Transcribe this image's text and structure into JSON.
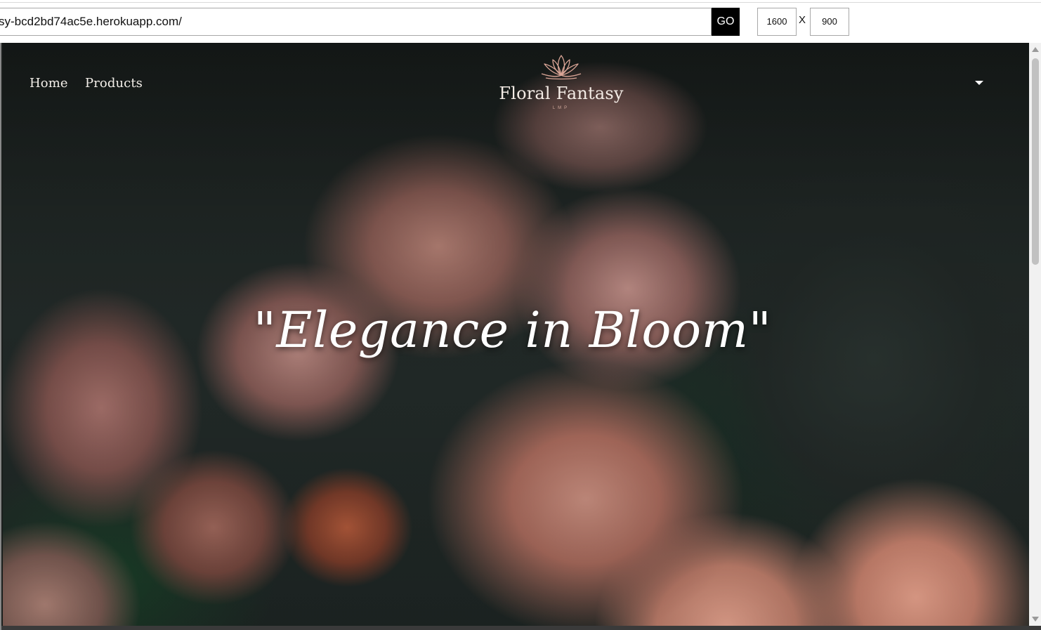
{
  "tester": {
    "url": "sy-bcd2bd74ac5e.herokuapp.com/",
    "go_label": "GO",
    "width_value": "1600",
    "separator": "X",
    "height_value": "900"
  },
  "site": {
    "nav": {
      "home_label": "Home",
      "products_label": "Products"
    },
    "logo": {
      "name": "Floral Fantasy",
      "tagline": "LMP",
      "icon": "lotus-icon"
    },
    "dropdown_icon": "caret-down-icon",
    "headline": "\"Elegance in Bloom\"",
    "colors": {
      "logo_mark": "#d9a596",
      "text_light": "#f3efe9",
      "go_button_bg": "#000000"
    }
  }
}
